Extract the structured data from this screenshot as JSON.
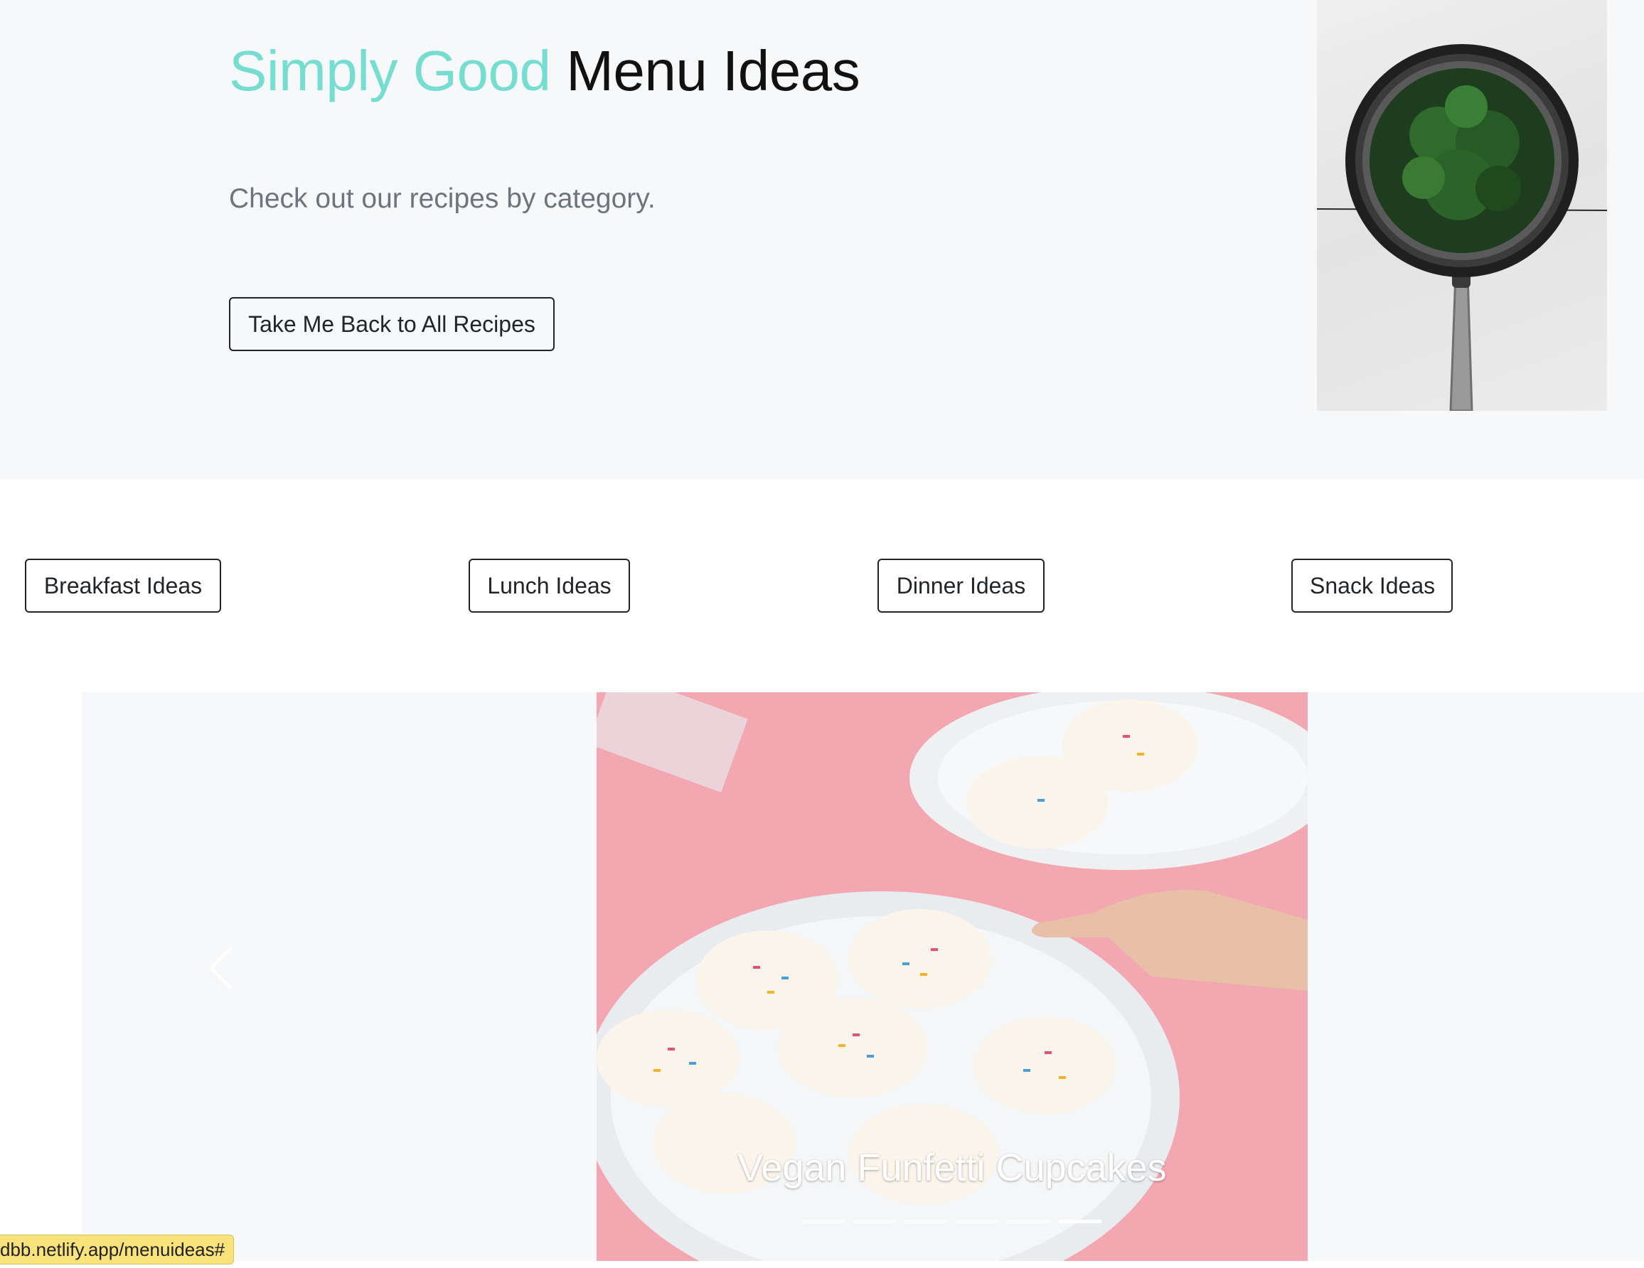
{
  "hero": {
    "title_accent": "Simply Good",
    "title_rest": "Menu Ideas",
    "subtitle": "Check out our recipes by category.",
    "back_button": "Take Me Back to All Recipes"
  },
  "categories": {
    "breakfast": "Breakfast Ideas",
    "lunch": "Lunch Ideas",
    "dinner": "Dinner Ideas",
    "snack": "Snack Ideas"
  },
  "carousel": {
    "caption": "Vegan Funfetti Cupcakes",
    "slide_count": 6,
    "active_index": 5
  },
  "status_bar": {
    "link": "dbb.netlify.app/menuideas#"
  },
  "colors": {
    "accent": "#76ddd1",
    "hero_bg": "#f7f8fa",
    "slide_bg": "#f2a7b1"
  }
}
